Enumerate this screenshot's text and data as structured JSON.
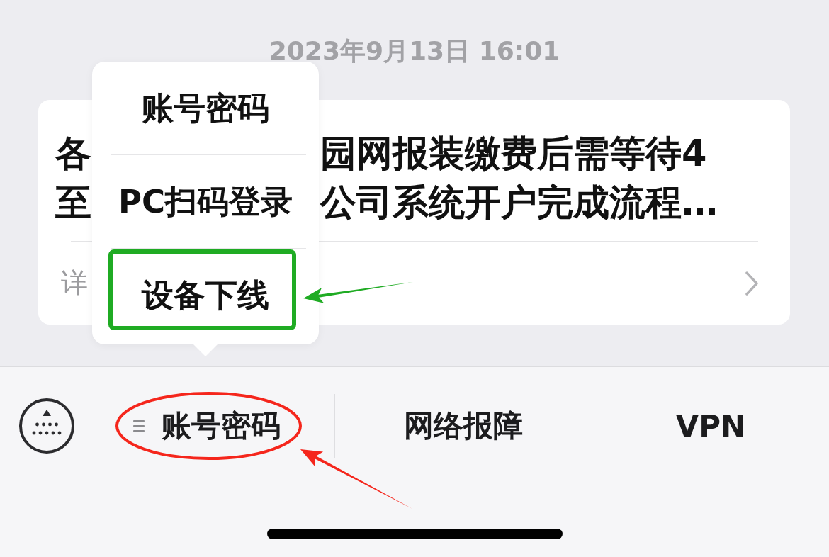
{
  "timestamp": "2023年9月13日 16:01",
  "article_card": {
    "title_lines": [
      {
        "left": "各",
        "right": "园网报装缴费后需等待4"
      },
      {
        "left": "至",
        "right": "公司系统开户完成流程…"
      }
    ],
    "footer_text": "详"
  },
  "bottom_menu": {
    "items": [
      {
        "kind": "submenu",
        "label": "账号密码",
        "expanded": true,
        "highlight": {
          "kind": "ellipse"
        },
        "submenu": [
          {
            "label": "账号密码"
          },
          {
            "label": "PC扫码登录"
          },
          {
            "label": "设备下线",
            "highlight": {
              "kind": "box"
            }
          }
        ]
      },
      {
        "kind": "link",
        "label": "网络报障"
      },
      {
        "kind": "link",
        "label": "VPN"
      }
    ]
  }
}
